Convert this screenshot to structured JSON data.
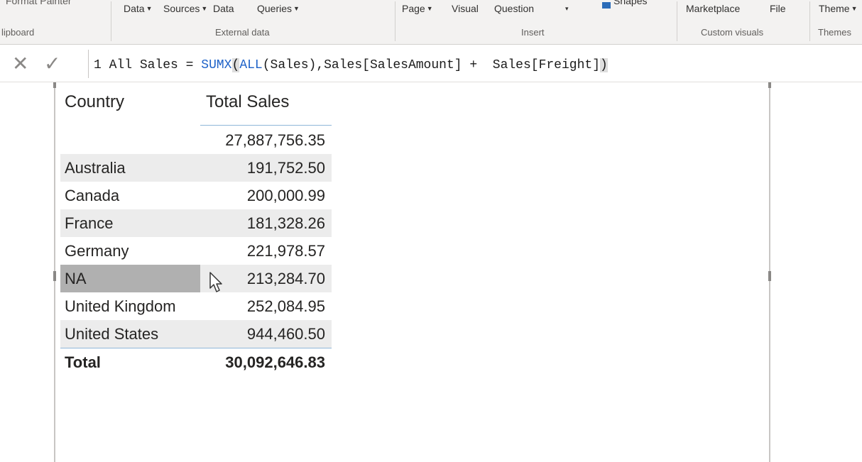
{
  "ribbon": {
    "top_items": [
      {
        "label": "Format Painter",
        "caret": false
      },
      {
        "label": "Data",
        "caret": true
      },
      {
        "label": "Sources",
        "caret": true
      },
      {
        "label": "Data",
        "caret": false
      },
      {
        "label": "Queries",
        "caret": true
      },
      {
        "label": "Page",
        "caret": true
      },
      {
        "label": "Visual",
        "caret": false
      },
      {
        "label": "Question",
        "caret": false
      },
      {
        "label": "▾",
        "caret": false
      },
      {
        "label": "Shapes",
        "caret": false
      },
      {
        "label": "Marketplace",
        "caret": false
      },
      {
        "label": "File",
        "caret": false
      },
      {
        "label": "Theme",
        "caret": true
      }
    ],
    "groups": {
      "clipboard": "lipboard",
      "external_data": "External data",
      "insert": "Insert",
      "custom_visuals": "Custom visuals",
      "themes": "Themes"
    }
  },
  "formula_bar": {
    "line_number": "1",
    "measure_name": "All Sales",
    "equals": "=",
    "fn1": "SUMX",
    "paren_open": "(",
    "fn2": "ALL",
    "middle": "(Sales),Sales[SalesAmount] +  Sales[Freight]",
    "paren_close": ")"
  },
  "table": {
    "headers": {
      "country": "Country",
      "total_sales": "Total Sales"
    },
    "rows": [
      {
        "country": "",
        "total": "27,887,756.35"
      },
      {
        "country": "Australia",
        "total": "191,752.50"
      },
      {
        "country": "Canada",
        "total": "200,000.99"
      },
      {
        "country": "France",
        "total": "181,328.26"
      },
      {
        "country": "Germany",
        "total": "221,978.57"
      },
      {
        "country": "NA",
        "total": "213,284.70"
      },
      {
        "country": "United Kingdom",
        "total": "252,084.95"
      },
      {
        "country": "United States",
        "total": "944,460.50"
      }
    ],
    "total": {
      "label": "Total",
      "value": "30,092,646.83"
    }
  },
  "icons": {
    "cancel": "close-icon",
    "commit": "checkmark-icon",
    "cursor": "mouse-pointer-icon"
  }
}
